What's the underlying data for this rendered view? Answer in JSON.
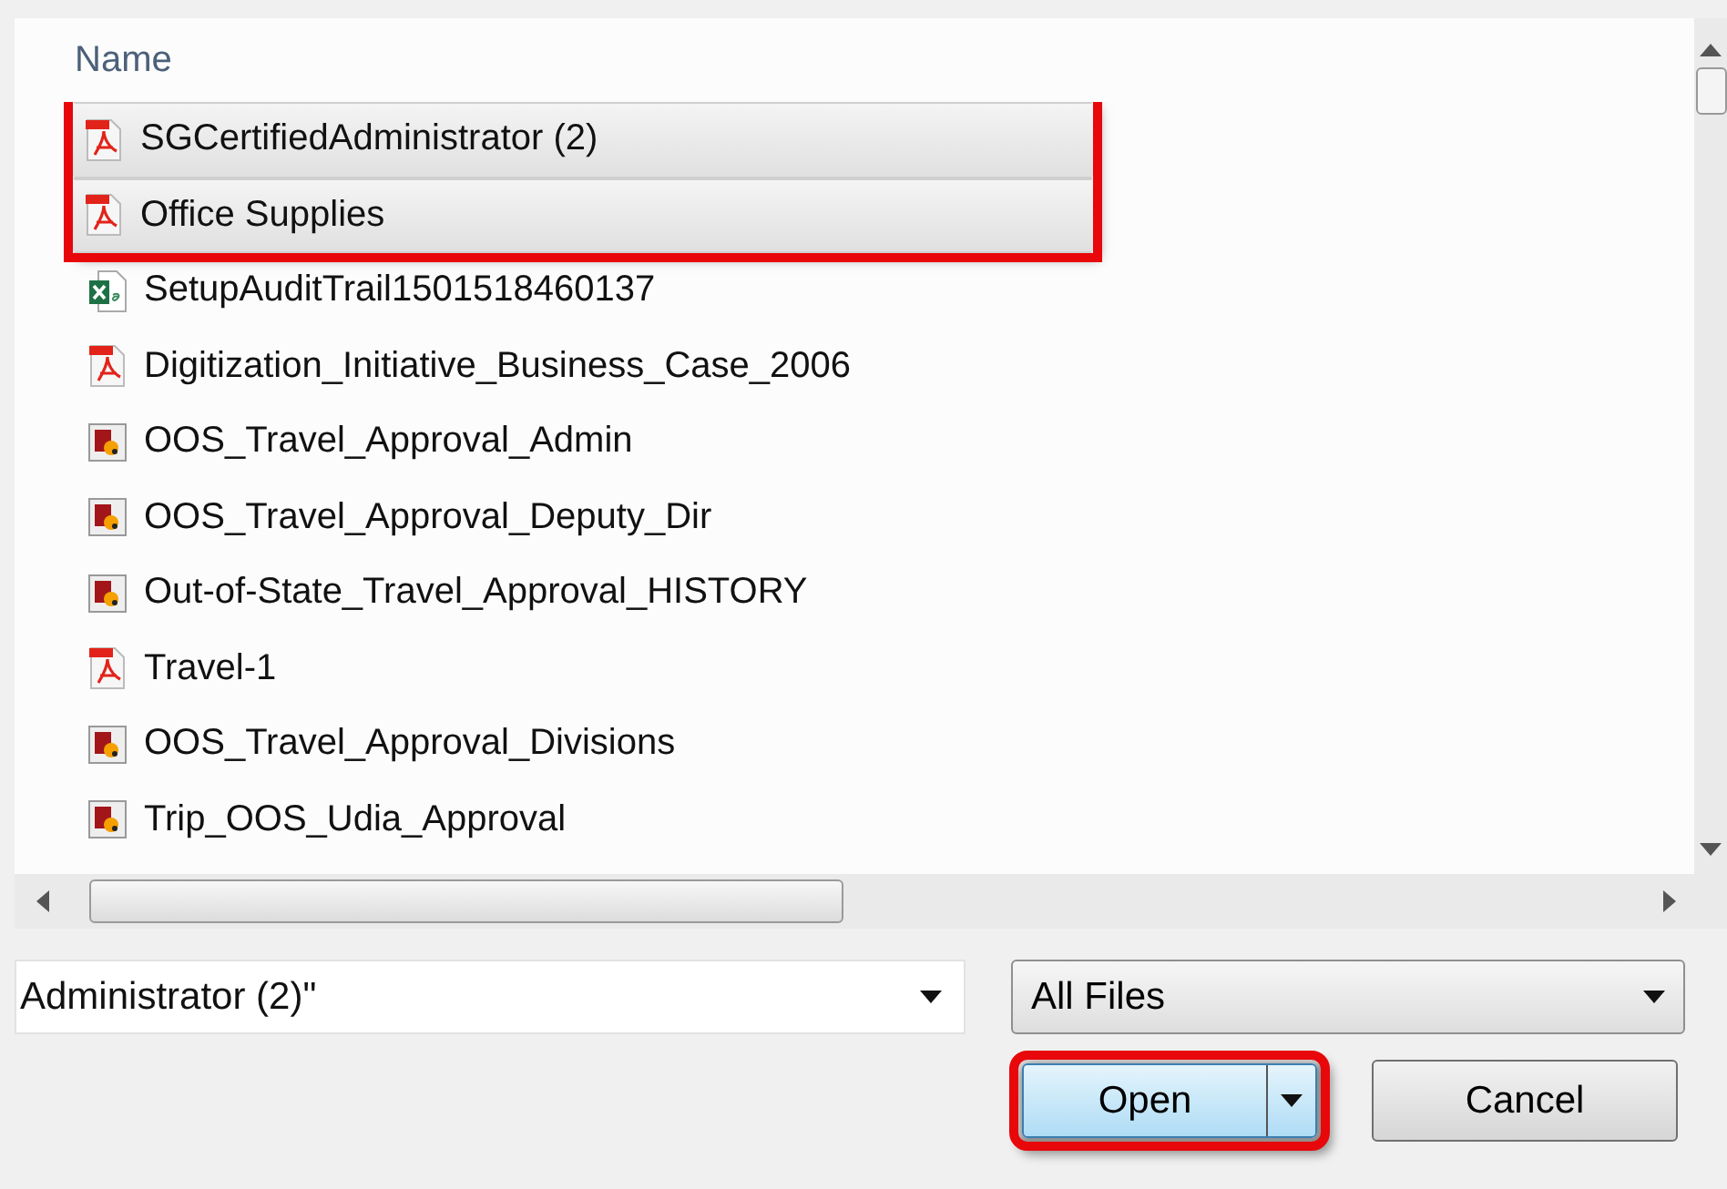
{
  "list": {
    "column": "Name",
    "highlight_selection": true,
    "files": [
      {
        "name": "SGCertifiedAdministrator (2)",
        "kind": "pdf",
        "selected": true
      },
      {
        "name": "Office Supplies",
        "kind": "pdf",
        "selected": true
      },
      {
        "name": "SetupAuditTrail1501518460137",
        "kind": "excel",
        "selected": false
      },
      {
        "name": "Digitization_Initiative_Business_Case_2006",
        "kind": "pdf",
        "selected": false
      },
      {
        "name": "OOS_Travel_Approval_Admin",
        "kind": "report",
        "selected": false
      },
      {
        "name": "OOS_Travel_Approval_Deputy_Dir",
        "kind": "report",
        "selected": false
      },
      {
        "name": "Out-of-State_Travel_Approval_HISTORY",
        "kind": "report",
        "selected": false
      },
      {
        "name": "Travel-1",
        "kind": "pdf",
        "selected": false
      },
      {
        "name": "OOS_Travel_Approval_Divisions",
        "kind": "report",
        "selected": false
      },
      {
        "name": "Trip_OOS_Udia_Approval",
        "kind": "report",
        "selected": false
      }
    ]
  },
  "filename": {
    "value": "Administrator (2)\""
  },
  "filter": {
    "value": "All Files"
  },
  "open_button": {
    "label": "Open",
    "highlighted": true
  },
  "cancel_button": {
    "label": "Cancel"
  }
}
